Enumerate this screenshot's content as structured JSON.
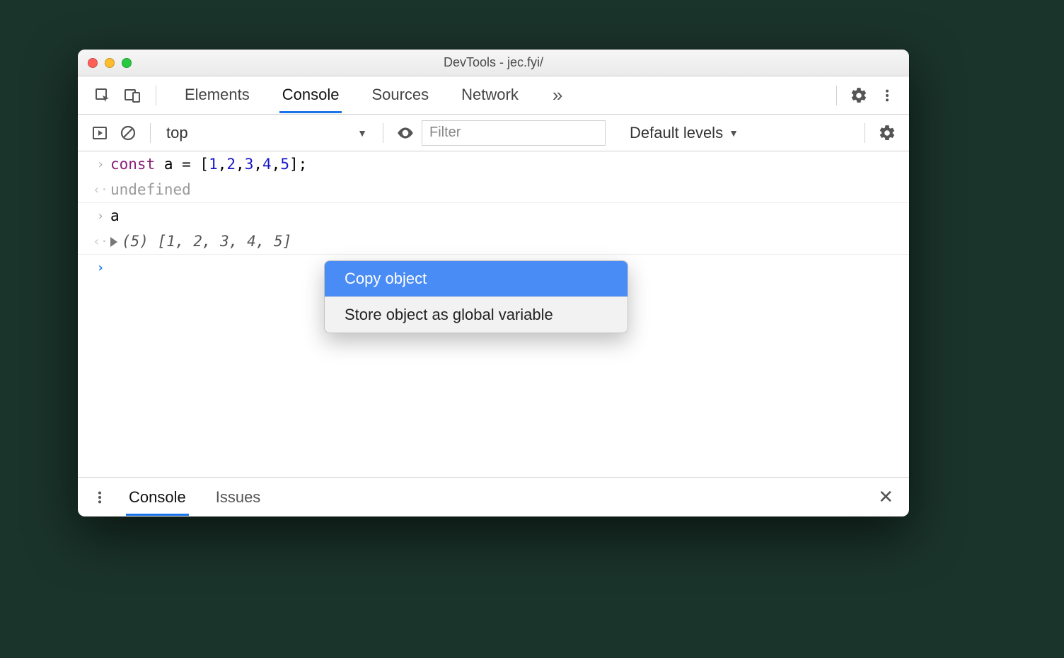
{
  "window": {
    "title": "DevTools - jec.fyi/"
  },
  "tabs": {
    "items": [
      "Elements",
      "Console",
      "Sources",
      "Network"
    ],
    "active_index": 1,
    "more_glyph": "»"
  },
  "toolbar": {
    "context": "top",
    "filter_placeholder": "Filter",
    "levels_label": "Default levels"
  },
  "console_rows": [
    {
      "type": "input",
      "code": {
        "tokens": [
          {
            "t": "kw",
            "v": "const"
          },
          {
            "t": "txt",
            "v": " a = ["
          },
          {
            "t": "num",
            "v": "1"
          },
          {
            "t": "txt",
            "v": ","
          },
          {
            "t": "num",
            "v": "2"
          },
          {
            "t": "txt",
            "v": ","
          },
          {
            "t": "num",
            "v": "3"
          },
          {
            "t": "txt",
            "v": ","
          },
          {
            "t": "num",
            "v": "4"
          },
          {
            "t": "txt",
            "v": ","
          },
          {
            "t": "num",
            "v": "5"
          },
          {
            "t": "txt",
            "v": "];"
          }
        ]
      }
    },
    {
      "type": "output",
      "undefined_label": "undefined"
    },
    {
      "type": "input",
      "plain": "a"
    },
    {
      "type": "output-array",
      "length_label": "(5)",
      "array_open": " [",
      "array_values": [
        "1",
        "2",
        "3",
        "4",
        "5"
      ],
      "array_close": "]"
    }
  ],
  "context_menu": {
    "items": [
      "Copy object",
      "Store object as global variable"
    ],
    "hover_index": 0
  },
  "drawer": {
    "tabs": [
      "Console",
      "Issues"
    ],
    "active_index": 0
  }
}
